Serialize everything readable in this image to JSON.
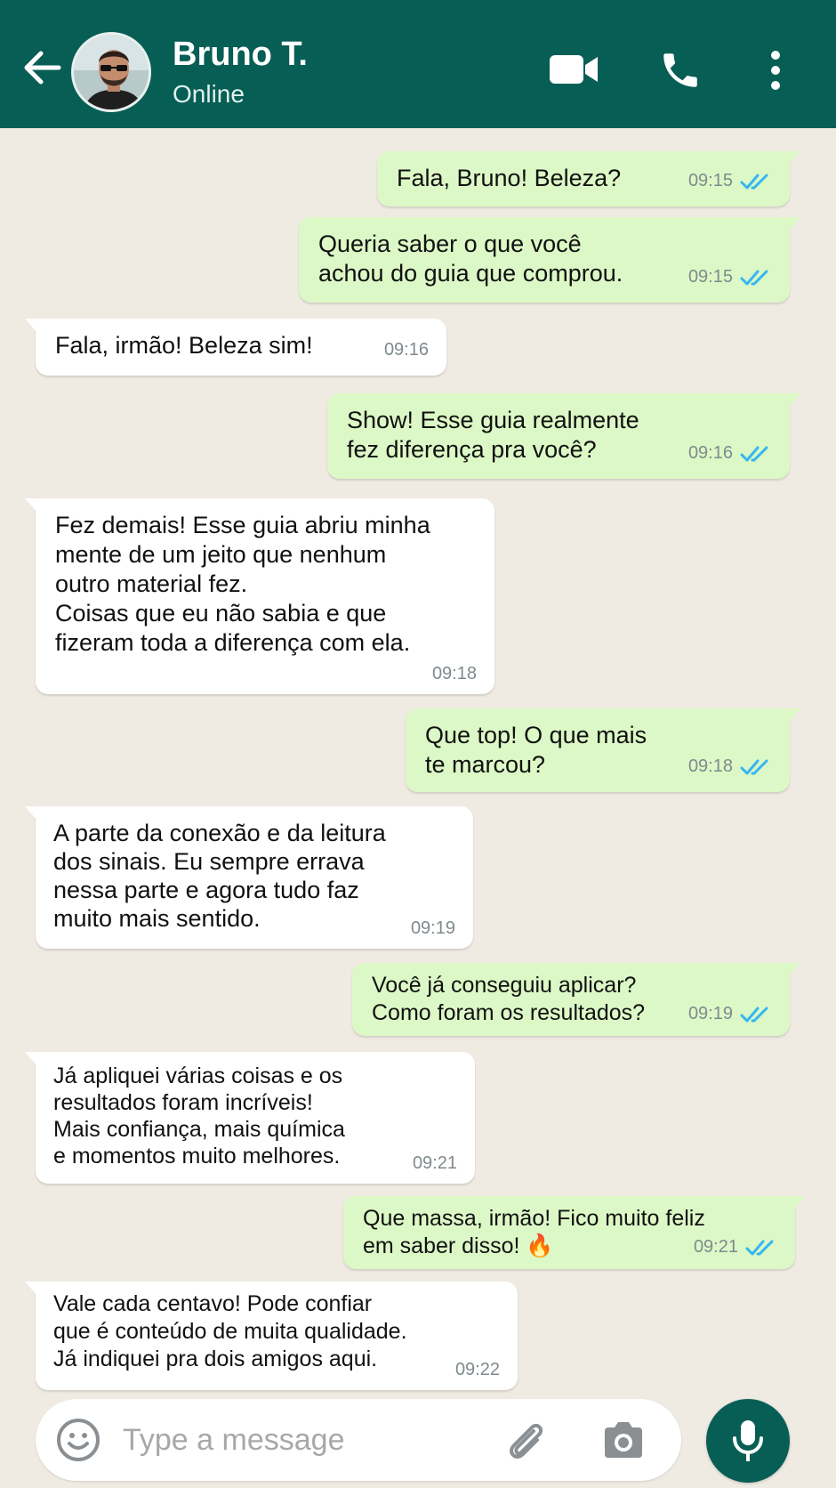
{
  "header": {
    "contact_name": "Bruno T.",
    "status": "Online",
    "colors": {
      "header_bg": "#075e54",
      "outgoing_bubble": "#dcf8c6",
      "incoming_bubble": "#ffffff",
      "chat_bg": "#efeae2",
      "read_ticks": "#34b7f1"
    },
    "icons": {
      "back": "arrow-left-icon",
      "video": "video-camera-icon",
      "call": "phone-icon",
      "more": "more-vertical-icon"
    }
  },
  "messages": [
    {
      "direction": "out",
      "text": "Fala, Bruno! Beleza?",
      "time": "09:15",
      "read": true
    },
    {
      "direction": "out",
      "text": "Queria saber o que você\nachou do guia que comprou.",
      "time": "09:15",
      "read": true
    },
    {
      "direction": "in",
      "text": "Fala, irmão! Beleza sim!",
      "time": "09:16"
    },
    {
      "direction": "out",
      "text": "Show! Esse guia realmente\nfez diferença pra você?",
      "time": "09:16",
      "read": true
    },
    {
      "direction": "in",
      "text": "Fez demais! Esse guia abriu minha\nmente de um jeito que nenhum\noutro material fez.\nCoisas que eu não sabia e que\nfizeram toda a diferença com ela.",
      "time": "09:18"
    },
    {
      "direction": "out",
      "text": "Que top! O que mais\nte marcou?",
      "time": "09:18",
      "read": true
    },
    {
      "direction": "in",
      "text": "A parte da conexão e da leitura\ndos sinais. Eu sempre errava\nnessa parte e agora tudo faz\nmuito mais sentido.",
      "time": "09:19"
    },
    {
      "direction": "out",
      "text": "Você já conseguiu aplicar?\nComo foram os resultados?",
      "time": "09:19",
      "read": true
    },
    {
      "direction": "in",
      "text": "Já apliquei várias coisas e os\nresultados foram incríveis!\nMais confiança, mais química\ne momentos muito melhores.",
      "time": "09:21"
    },
    {
      "direction": "out",
      "text": "Que massa, irmão! Fico muito feliz\nem saber disso! 🔥",
      "time": "09:21",
      "read": true
    },
    {
      "direction": "in",
      "text": "Vale cada centavo! Pode confiar\nque é conteúdo de muita qualidade.\nJá indiquei pra dois amigos aqui.",
      "time": "09:22"
    }
  ],
  "composer": {
    "placeholder": "Type a message",
    "icons": {
      "emoji": "emoji-icon",
      "attach": "paperclip-icon",
      "camera": "camera-icon",
      "mic": "microphone-icon"
    }
  }
}
